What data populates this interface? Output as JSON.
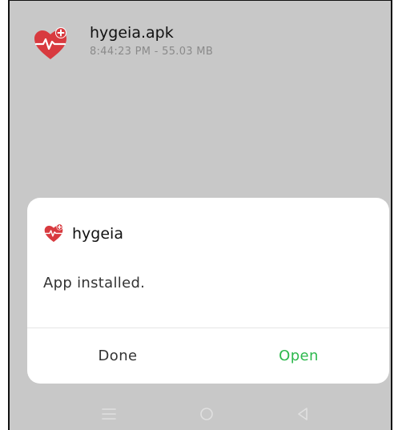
{
  "notification": {
    "file_name": "hygeia.apk",
    "meta": "8:44:23 PM - 55.03 MB",
    "icon": "heart-pulse-icon"
  },
  "dialog": {
    "app_name": "hygeia",
    "app_icon": "heart-pulse-icon",
    "message": "App installed.",
    "done_label": "Done",
    "open_label": "Open"
  },
  "navbar": {
    "menu_icon": "menu-icon",
    "home_icon": "home-icon",
    "back_icon": "back-icon"
  },
  "colors": {
    "backdrop": "#c8c8c8",
    "accent_green": "#2db84d",
    "heart_red": "#d83a3f",
    "nav_icon": "#e0e0e0"
  }
}
